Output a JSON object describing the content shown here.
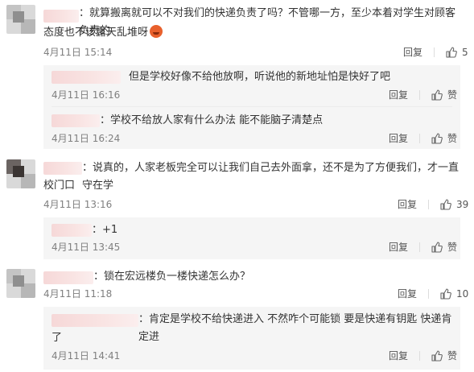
{
  "comments": [
    {
      "text_line1": "：就算搬离就可以不对我们的快递负责了吗？不管哪一方，至少本着对学生对顾客负责的",
      "text_line2": "态度也不该露天乱堆呀",
      "time": "4月11日 15:14",
      "reply_label": "回复",
      "likes": "5",
      "replies": [
        {
          "text": "但是学校好像不给他放啊，听说他的新地址怕是快好了吧",
          "time": "4月11日 16:16",
          "reply_label": "回复",
          "like_label": "赞"
        },
        {
          "text": "：学校不给放人家有什么办法 能不能脑子清楚点",
          "time": "4月11日 16:24",
          "reply_label": "回复",
          "like_label": "赞"
        }
      ]
    },
    {
      "text_line1": "：说真的，人家老板完全可以让我们自己去外面拿，还不是为了方便我们，才一直守在学",
      "text_line2": "校门口",
      "time": "4月11日 13:16",
      "reply_label": "回复",
      "likes": "39",
      "replies": [
        {
          "text": "：+1",
          "time": "4月11日 13:45",
          "reply_label": "回复",
          "like_label": "赞"
        }
      ]
    },
    {
      "text_line1": "：锁在宏远楼负一楼快递怎么办？",
      "time": "4月11日 11:18",
      "reply_label": "回复",
      "likes": "10",
      "replies": [
        {
          "text_line1": "：肯定是学校不给快递进入 不然咋个可能锁 要是快递有钥匙 快递肯定进",
          "text_line2": "了",
          "time": "4月11日 14:41",
          "reply_label": "回复",
          "like_label": "赞"
        }
      ]
    }
  ],
  "icons": {
    "like": "thumbs-up-icon"
  },
  "colors": {
    "text": "#333333",
    "meta": "#808080",
    "sub_bg": "#f5f5f5",
    "redacted_name": "#f6d8d8"
  }
}
